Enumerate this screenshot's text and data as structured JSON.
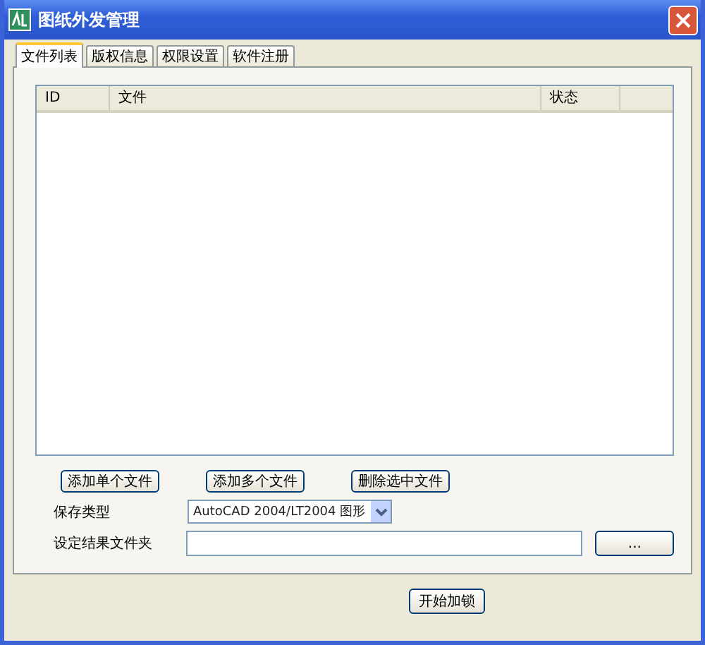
{
  "window": {
    "title": "图纸外发管理"
  },
  "tabs": [
    {
      "label": "文件列表",
      "selected": true
    },
    {
      "label": "版权信息",
      "selected": false
    },
    {
      "label": "权限设置",
      "selected": false
    },
    {
      "label": "软件注册",
      "selected": false
    }
  ],
  "table": {
    "columns": [
      "ID",
      "文件",
      "状态"
    ]
  },
  "list_buttons": [
    "添加单个文件",
    "添加多个文件",
    "删除选中文件"
  ],
  "save_type": {
    "label": "保存类型",
    "value": "AutoCAD 2004/LT2004 图形"
  },
  "output_folder": {
    "label": "设定结果文件夹",
    "browse": "..."
  },
  "start_button": "开始加锁"
}
